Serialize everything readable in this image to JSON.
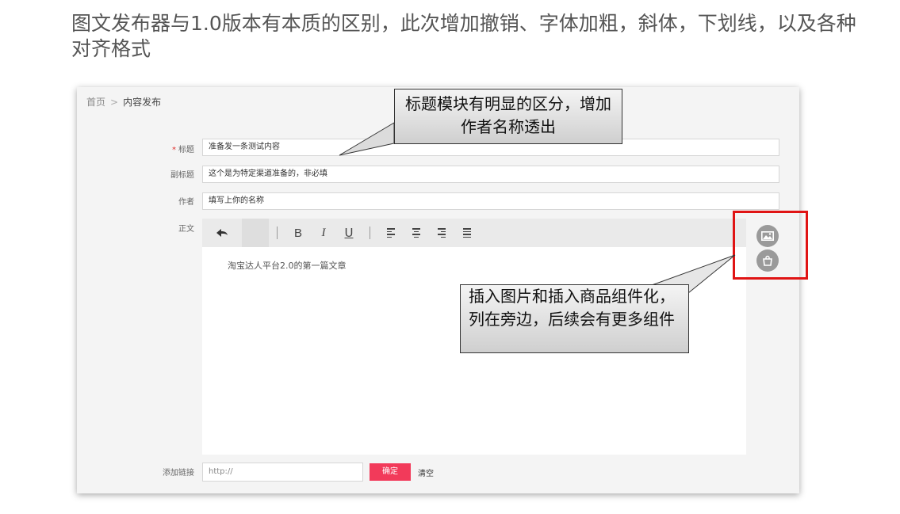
{
  "slide": {
    "title": "图文发布器与1.0版本有本质的区别，此次增加撤销、字体加粗，斜体，下划线，以及各种对齐格式"
  },
  "breadcrumb": {
    "home": "首页",
    "separator": ">",
    "current": "内容发布"
  },
  "form": {
    "title_label": "标题",
    "required_mark": "*",
    "title_value": "准备发一条测试内容",
    "subtitle_label": "副标题",
    "subtitle_value": "这个是为特定渠道准备的，非必填",
    "author_label": "作者",
    "author_value": "填写上你的名称",
    "body_label": "正文"
  },
  "toolbar": {
    "undo_icon": "undo-icon",
    "bold": "B",
    "italic": "I",
    "underline": "U",
    "align_icons": [
      "align-left-icon",
      "align-center-icon",
      "align-right-icon",
      "align-justify-icon"
    ]
  },
  "editor": {
    "content": "淘宝达人平台2.0的第一篇文章"
  },
  "side_tools": {
    "icons": [
      "insert-image-icon",
      "insert-product-icon"
    ]
  },
  "link": {
    "label": "添加链接",
    "placeholder": "http://",
    "confirm_label": "确定",
    "clear_label": "清空"
  },
  "callouts": {
    "title_module": "标题模块有明显的区分，增加作者名称透出",
    "insert_components": "插入图片和插入商品组件化，列在旁边，后续会有更多组件"
  },
  "colors": {
    "accent": "#f23a5a",
    "highlight_box": "#e01414",
    "required": "#e0302c"
  }
}
